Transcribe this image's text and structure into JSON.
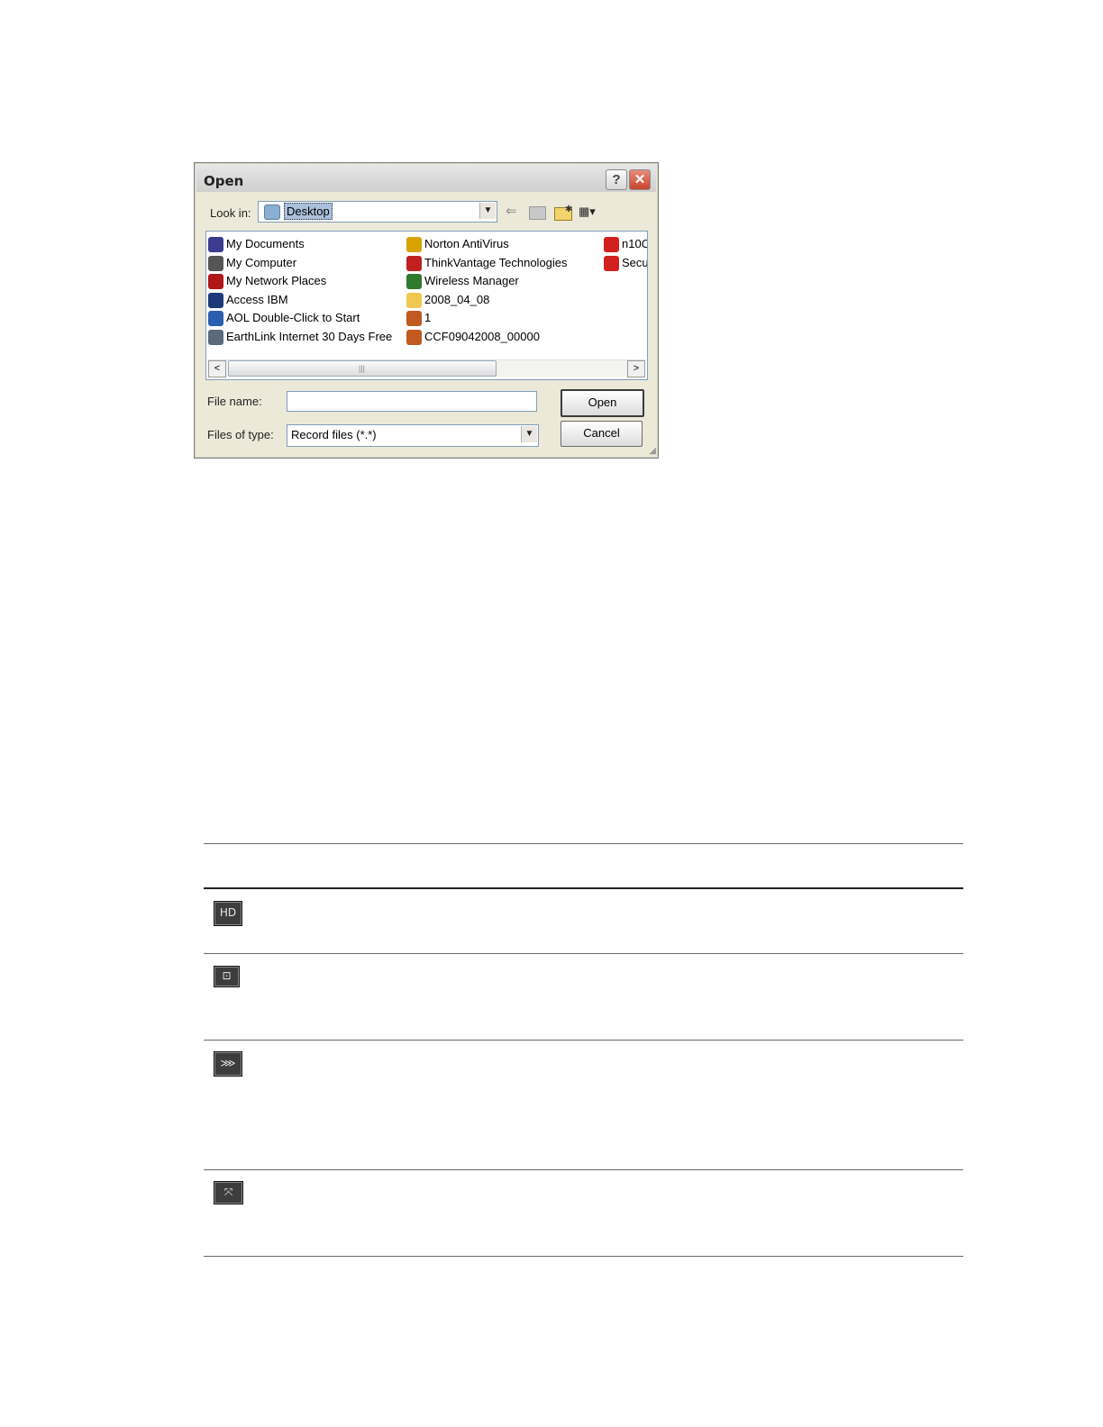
{
  "dialog": {
    "title": "Open",
    "help_glyph": "?",
    "close_glyph": "✕",
    "look_in_label": "Look in:",
    "look_in_value": "Desktop",
    "toolbar_icons": [
      "back-arrow-icon",
      "up-folder-icon",
      "new-folder-icon",
      "view-menu-icon"
    ],
    "files": {
      "column1": [
        {
          "name": "My Documents",
          "icon": "my-documents-icon",
          "color": "#3b3b8f"
        },
        {
          "name": "My Computer",
          "icon": "my-computer-icon",
          "color": "#555555"
        },
        {
          "name": "My Network Places",
          "icon": "network-places-icon",
          "color": "#b01818"
        },
        {
          "name": "Access IBM",
          "icon": "access-ibm-icon",
          "color": "#1a3a7a"
        },
        {
          "name": "AOL Double-Click to Start",
          "icon": "aol-icon",
          "color": "#2a5fb0"
        },
        {
          "name": "EarthLink Internet 30 Days Free",
          "icon": "earthlink-icon",
          "color": "#5a6a7a"
        }
      ],
      "column2": [
        {
          "name": "Norton AntiVirus",
          "icon": "norton-icon",
          "color": "#d8a200"
        },
        {
          "name": "ThinkVantage Technologies",
          "icon": "thinkvantage-icon",
          "color": "#c02020"
        },
        {
          "name": "Wireless Manager",
          "icon": "wireless-manager-icon",
          "color": "#2f7a2f"
        },
        {
          "name": "2008_04_08",
          "icon": "folder-icon",
          "color": "#f0c850"
        },
        {
          "name": "1",
          "icon": "record-file-icon",
          "color": "#c05a20"
        },
        {
          "name": "CCF09042008_00000",
          "icon": "record-file-icon",
          "color": "#c05a20"
        }
      ],
      "column3": [
        {
          "name": "n10C",
          "icon": "pdf-icon",
          "color": "#d02020"
        },
        {
          "name": "Secu",
          "icon": "pdf-icon",
          "color": "#d02020"
        }
      ]
    },
    "scroll_left": "<",
    "scroll_right": ">",
    "scroll_grip": "|||",
    "file_name_label": "File name:",
    "file_name_value": "",
    "files_of_type_label": "Files of type:",
    "files_of_type_value": "Record files (*.*)",
    "open_button": "Open",
    "cancel_button": "Cancel"
  },
  "icon_table": {
    "rows": [
      {
        "icon": "hd-icon",
        "glyph": "HD"
      },
      {
        "icon": "fit-window-icon",
        "glyph": "⊡"
      },
      {
        "icon": "stretch-icon",
        "glyph": "⋙"
      },
      {
        "icon": "fullscreen-icon",
        "glyph": "⤧"
      }
    ]
  }
}
